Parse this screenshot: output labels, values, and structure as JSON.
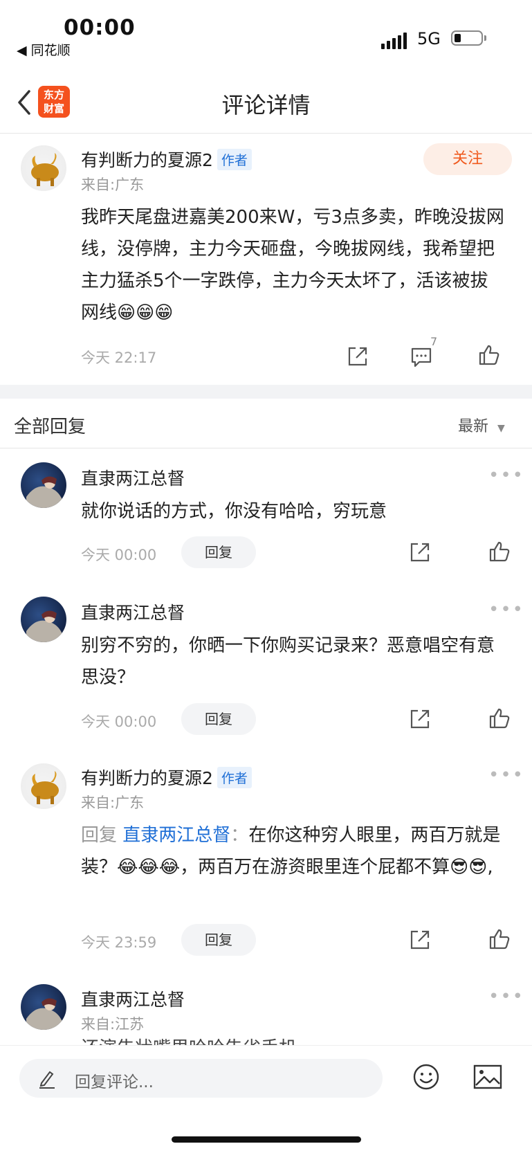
{
  "status_bar": {
    "time": "00:00",
    "back_app": "◀ 同花顺",
    "network": "5G"
  },
  "nav": {
    "title": "评论详情",
    "logo_line1": "东方",
    "logo_line2": "财富"
  },
  "main_post": {
    "username": "有判断力的夏源2",
    "author_tag": "作者",
    "location": "来自:广东",
    "follow_label": "关注",
    "text": "我昨天尾盘进嘉美200来W，亏3点多卖，昨晚没拔网线，没停牌，主力今天砸盘，今晚拔网线，我希望把主力猛杀5个一字跌停，主力今天太坏了，活该被拔网线😁😁😁",
    "time": "今天 22:17",
    "comment_count": "7"
  },
  "replies_header": {
    "title": "全部回复",
    "sort": "最新"
  },
  "replies": [
    {
      "username": "直隶两江总督",
      "text": "就你说话的方式，你没有哈哈，穷玩意",
      "time": "今天 00:00",
      "reply_label": "回复"
    },
    {
      "username": "直隶两江总督",
      "text": "别穷不穷的，你晒一下你购买记录来？恶意唱空有意思没？",
      "time": "今天 00:00",
      "reply_label": "回复"
    },
    {
      "username": "有判断力的夏源2",
      "author_tag": "作者",
      "location": "来自:广东",
      "reply_prefix": "回复",
      "reply_to": "直隶两江总督",
      "reply_sep": "：",
      "text": "在你这种穷人眼里，两百万就是装？😂😂😂，两百万在游资眼里连个屁都不算😎😎,",
      "time": "今天 23:59",
      "reply_label": "回复"
    },
    {
      "username": "直隶两江总督",
      "location": "来自:江苏",
      "text": "还演告状嘴里哈哈告省手机"
    }
  ],
  "bottom_bar": {
    "placeholder": "回复评论..."
  },
  "colors": {
    "accent": "#f05a1e",
    "link": "#1f6fd6",
    "logo": "#f4511e"
  }
}
